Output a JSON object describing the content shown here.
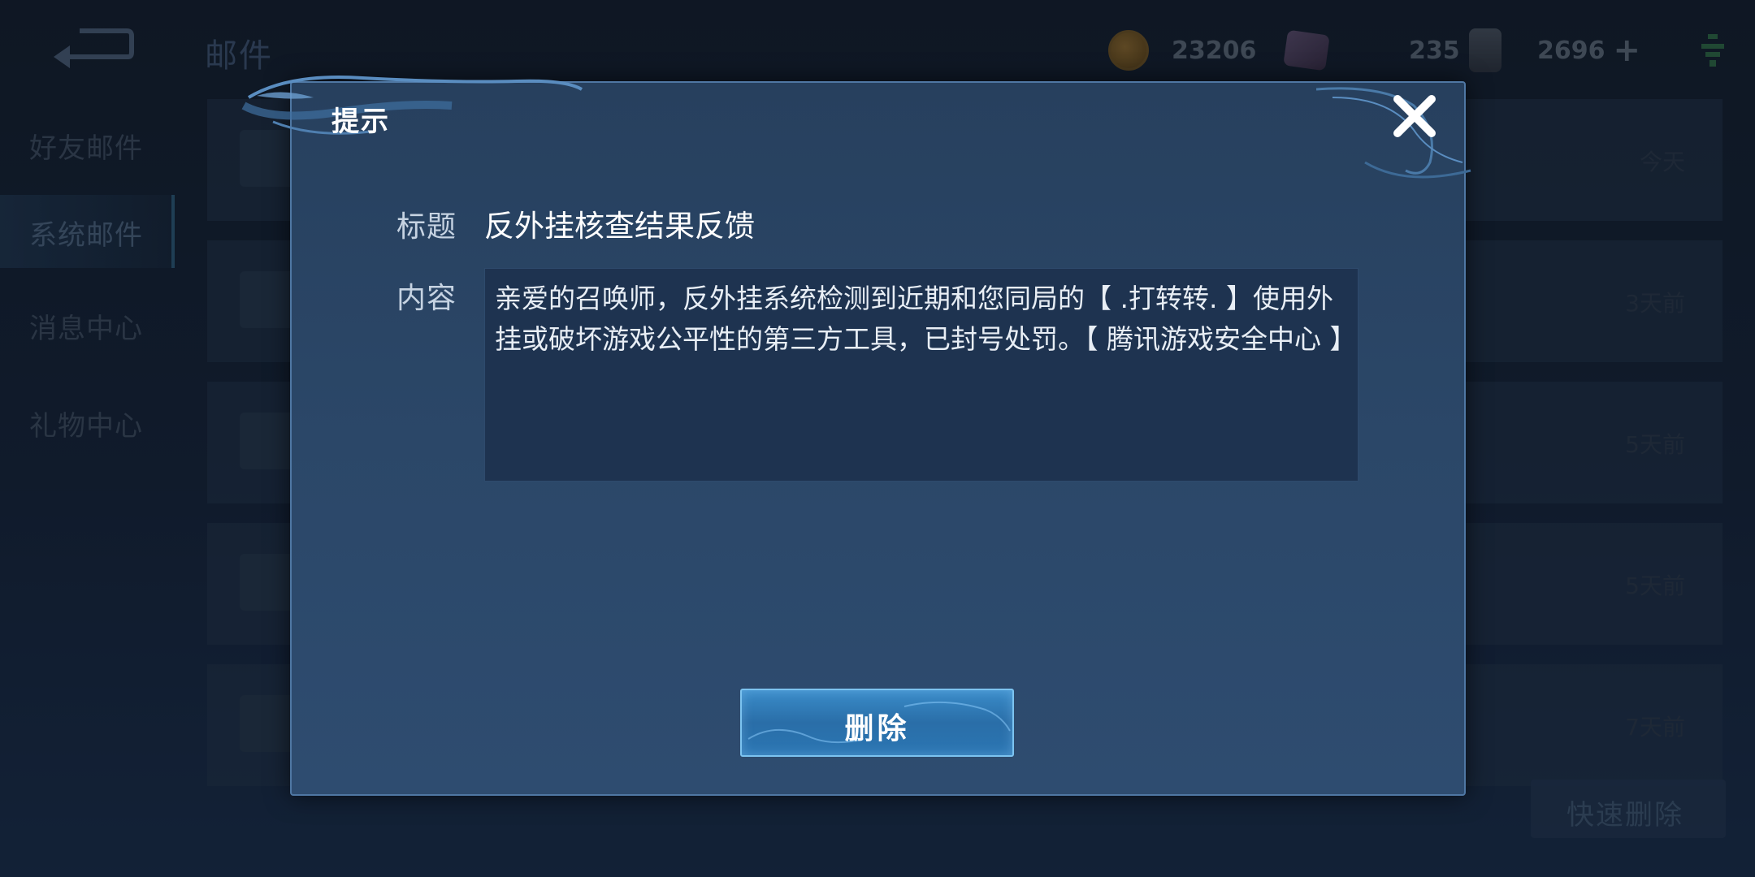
{
  "header": {
    "title": "邮件",
    "gold": "23206",
    "diamond": "235",
    "cards": "2696"
  },
  "sidebar": {
    "items": [
      {
        "label": "好友邮件"
      },
      {
        "label": "系统邮件"
      },
      {
        "label": "消息中心"
      },
      {
        "label": "礼物中心"
      }
    ],
    "active_index": 1
  },
  "mail_list": {
    "dates": [
      "今天",
      "3天前",
      "5天前",
      "5天前",
      "7天前"
    ]
  },
  "quick_delete_label": "快速删除",
  "dialog": {
    "title": "提示",
    "subject_label": "标题",
    "subject": "反外挂核查结果反馈",
    "content_label": "内容",
    "content": "亲爱的召唤师，反外挂系统检测到近期和您同局的【 .打转转. 】使用外挂或破坏游戏公平性的第三方工具，已封号处罚。【 腾讯游戏安全中心 】",
    "delete_label": "删除"
  },
  "icons": {
    "back": "back-arrow-icon",
    "gold": "gold-coin-icon",
    "diamond": "diamond-icon",
    "card": "card-icon",
    "plus": "plus-icon",
    "wifi": "wifi-icon",
    "close": "close-icon"
  },
  "colors": {
    "dialog_bg": "#2b4768",
    "button_blue": "#2a6ea8",
    "button_border": "#7cc3f0"
  }
}
